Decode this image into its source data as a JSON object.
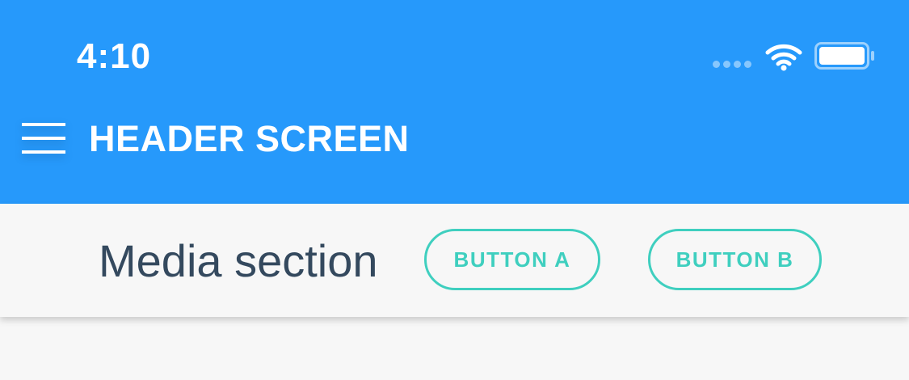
{
  "status_bar": {
    "time": "4:10",
    "icons": [
      "signal-dots-icon",
      "wifi-icon",
      "battery-icon"
    ]
  },
  "header": {
    "title": "HEADER SCREEN",
    "menu_icon": "hamburger-menu-icon"
  },
  "media_section": {
    "label": "Media section",
    "button_a_label": "BUTTON A",
    "button_b_label": "BUTTON B"
  },
  "colors": {
    "header_background": "#2699fb",
    "accent": "#3fcfbf",
    "label_text": "#34495e",
    "page_background": "#f7f7f7"
  }
}
